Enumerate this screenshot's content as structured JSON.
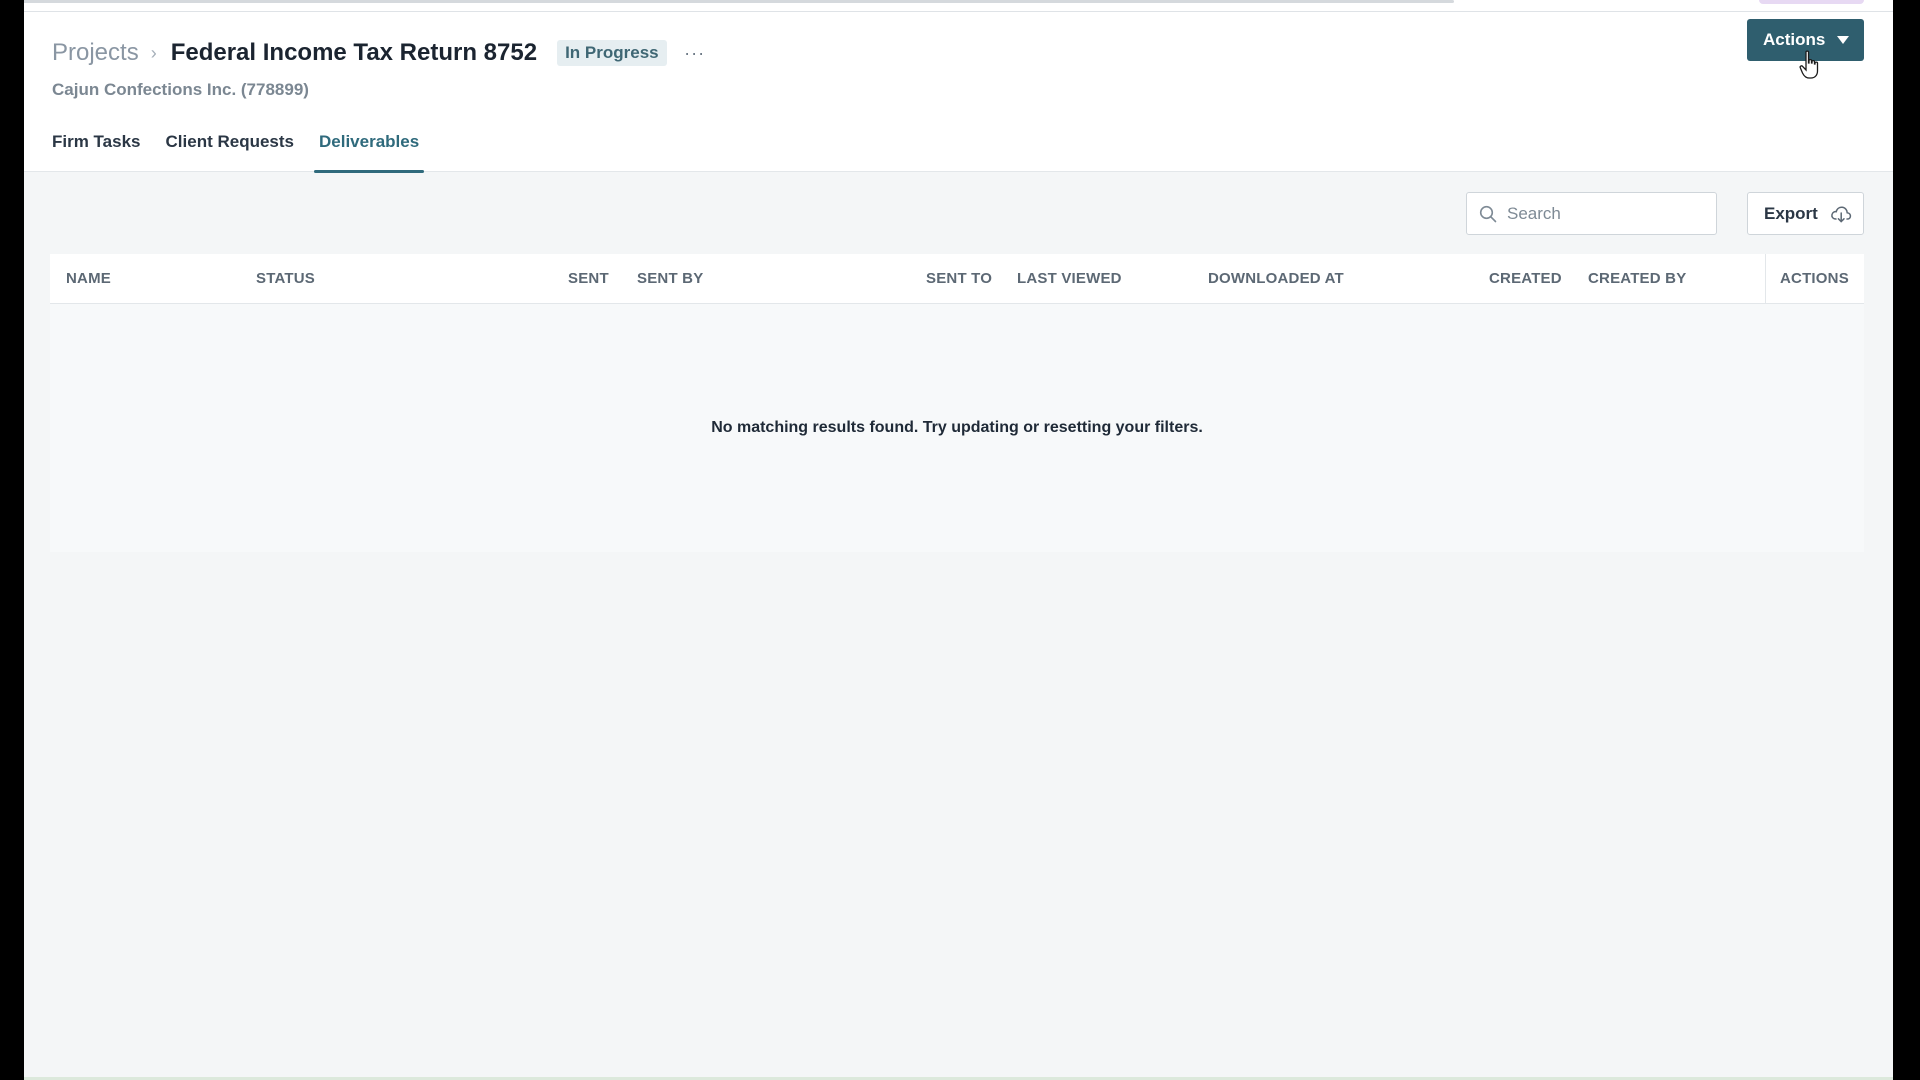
{
  "breadcrumb": {
    "parent": "Projects",
    "separator": "›",
    "title": "Federal Income Tax Return 8752",
    "status": "In Progress",
    "more": "···"
  },
  "client": "Cajun Confections Inc. (778899)",
  "header": {
    "actions_label": "Actions"
  },
  "tabs": [
    {
      "label": "Firm Tasks",
      "active": false
    },
    {
      "label": "Client Requests",
      "active": false
    },
    {
      "label": "Deliverables",
      "active": true
    }
  ],
  "toolbar": {
    "search_placeholder": "Search",
    "export_label": "Export"
  },
  "table": {
    "columns": [
      "NAME",
      "STATUS",
      "SENT",
      "SENT BY",
      "SENT TO",
      "LAST VIEWED",
      "DOWNLOADED AT",
      "CREATED",
      "CREATED BY",
      "ACTIONS"
    ],
    "empty_message": "No matching results found. Try updating or resetting your filters."
  },
  "colors": {
    "accent": "#2f5e6e",
    "tab_active": "#2f6a7c",
    "badge_bg": "#e6eef1",
    "badge_text": "#3f6774"
  }
}
